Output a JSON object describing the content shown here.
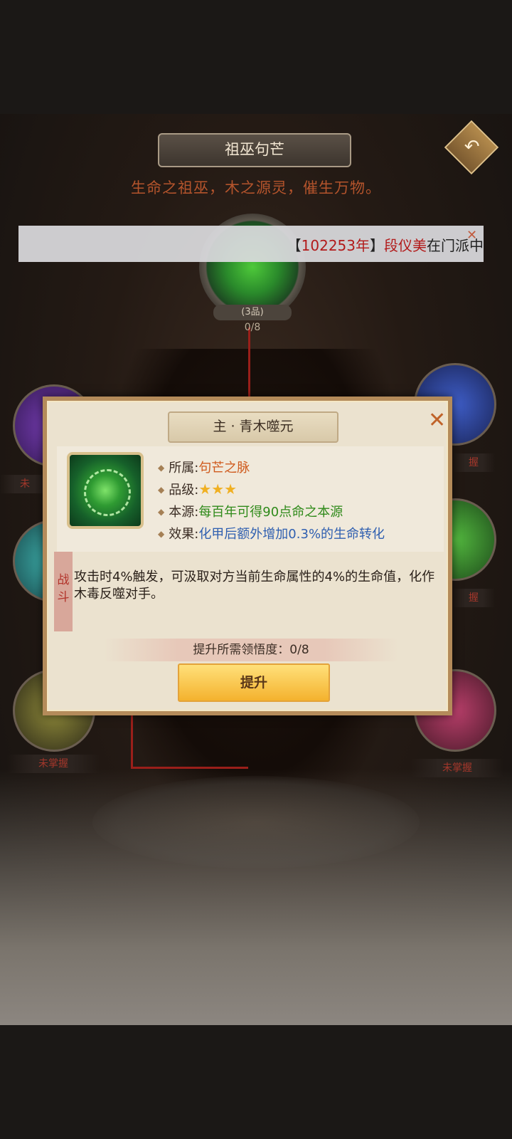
{
  "header": {
    "title": "祖巫句芒",
    "subtitle": "生命之祖巫，木之源灵，催生万物。",
    "back_icon": "back-arrow-icon"
  },
  "center_node": {
    "grade": "(3品)",
    "progress": "0/8"
  },
  "side_nodes": {
    "left_top_label": "未",
    "left_bottom_label": "未掌握",
    "right_top_label": "握",
    "right_mid_label": "握",
    "right_bottom_label": "未掌握"
  },
  "ticker": {
    "open_bracket": "【",
    "year": "102253年",
    "close_bracket": "】",
    "name": "段仪美",
    "text": "在门派中"
  },
  "panel": {
    "title": "主 · 青木噬元",
    "rows": [
      {
        "key": "所属",
        "value": "句芒之脉"
      },
      {
        "key": "品级",
        "value": "★★★"
      },
      {
        "key": "本源",
        "value": "每百年可得90点命之本源"
      },
      {
        "key": "效果",
        "value": "化甲后额外增加0.3%的生命转化"
      }
    ],
    "combat_tag": "战斗",
    "description": "攻击时4%触发，可汲取对方当前生命属性的4%的生命值，化作木毒反噬对手。",
    "requirement": "提升所需领悟度：0/8",
    "upgrade_label": "提升",
    "close_symbol": "✕"
  },
  "colors": {
    "accent_orange": "#cf5a1d",
    "accent_green": "#2f8a1a",
    "accent_blue": "#2f5fb0",
    "button_gold": "#f4b22e"
  }
}
